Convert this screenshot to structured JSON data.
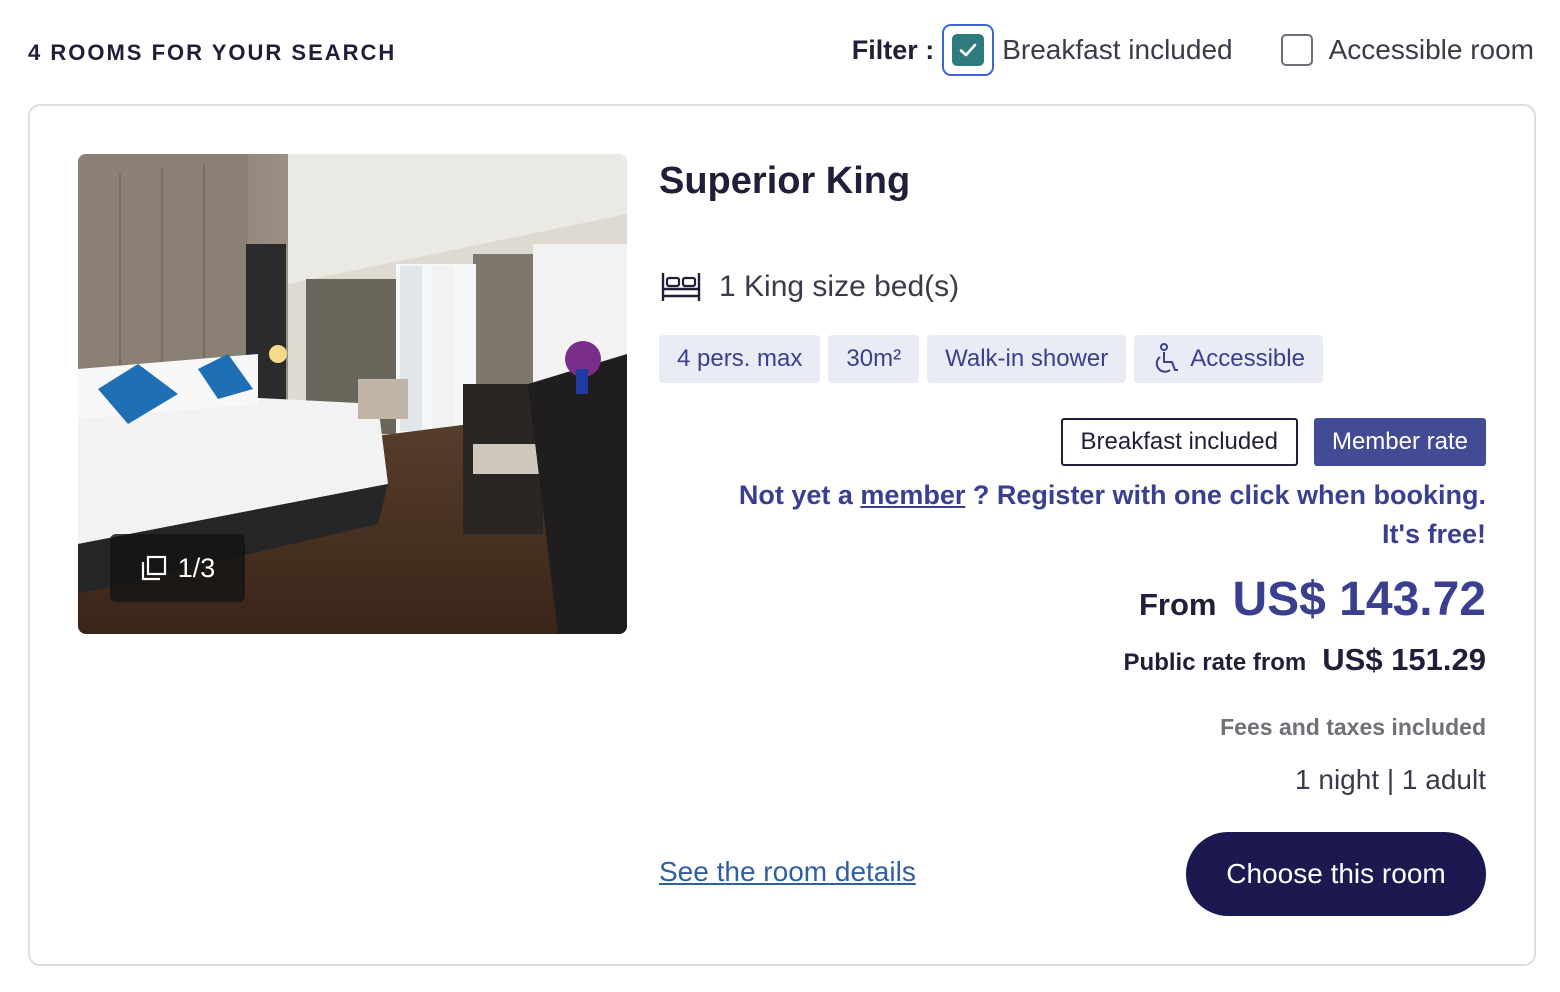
{
  "results": {
    "count_label": "4 ROOMS FOR YOUR SEARCH"
  },
  "filter": {
    "label": "Filter :",
    "options": [
      {
        "label": "Breakfast included",
        "checked": true
      },
      {
        "label": "Accessible room",
        "checked": false
      }
    ]
  },
  "room": {
    "photo": {
      "counter": "1/3",
      "icon": "gallery-icon"
    },
    "title": "Superior King",
    "bed": {
      "icon": "bed-icon",
      "label": "1 King size bed(s)"
    },
    "tags": [
      {
        "label": "4 pers. max"
      },
      {
        "label": "30m²"
      },
      {
        "label": "Walk-in shower"
      },
      {
        "label": "Accessible",
        "icon": "wheelchair-icon"
      }
    ],
    "rate_badges": {
      "breakfast": "Breakfast included",
      "member": "Member rate"
    },
    "member_promo": {
      "prefix": "Not yet a ",
      "link": "member",
      "suffix": " ? Register with one click when booking. It's free!"
    },
    "price": {
      "from_label": "From",
      "from_value": "US$ 143.72",
      "public_label": "Public rate from",
      "public_value": "US$ 151.29",
      "fees_note": "Fees and taxes included",
      "stay": "1 night | 1 adult"
    },
    "details_link": "See the room details",
    "choose_button": "Choose this room"
  },
  "colors": {
    "accent": "#3a3f8f",
    "button_bg": "#1c1850",
    "checkbox_checked": "#2f7a7d",
    "tag_bg": "#e9ebf5"
  }
}
